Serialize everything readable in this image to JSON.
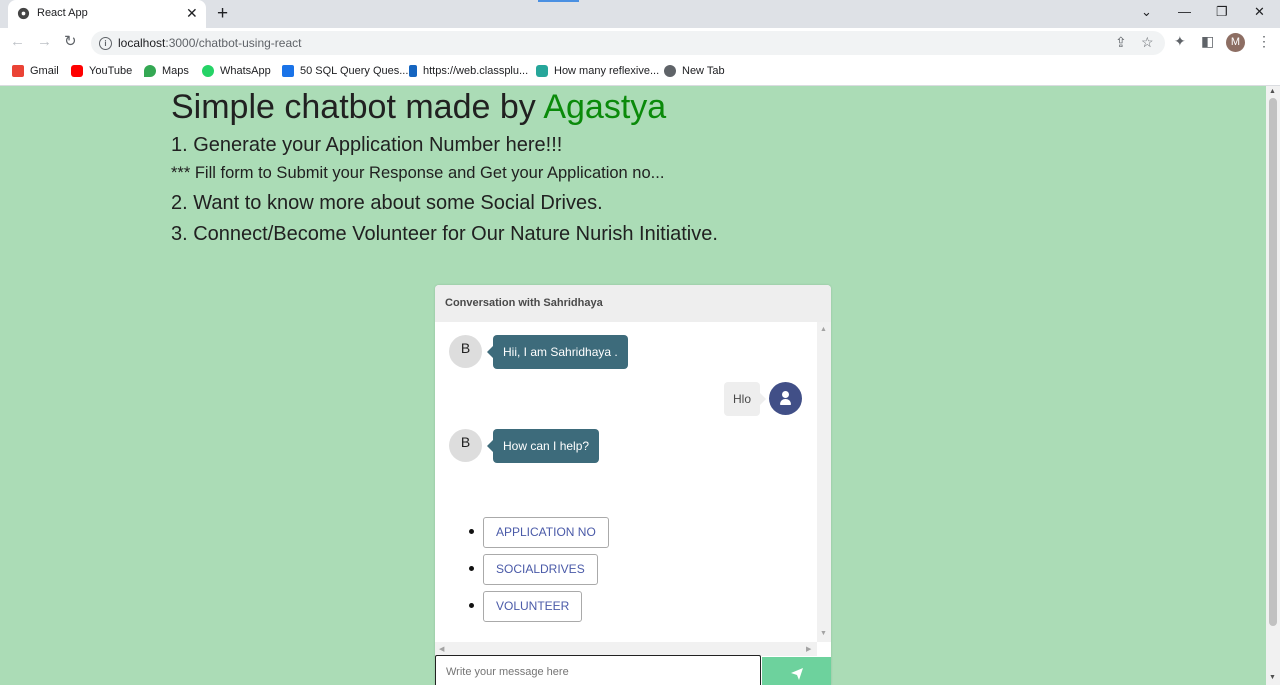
{
  "browser": {
    "tab_title": "React App",
    "tab_close": "✕",
    "new_tab": "+",
    "window_controls": {
      "dropdown": "⌄",
      "minimize": "—",
      "restore": "❐",
      "close": "✕"
    },
    "url_host": "localhost",
    "url_path": ":3000/chatbot-using-react",
    "profile_initial": "M",
    "bookmarks": [
      {
        "label": "Gmail",
        "icon": "gmail-icon",
        "color": "#ea4335"
      },
      {
        "label": "YouTube",
        "icon": "youtube-icon",
        "color": "#ff0000"
      },
      {
        "label": "Maps",
        "icon": "maps-icon",
        "color": "#34a853"
      },
      {
        "label": "WhatsApp",
        "icon": "whatsapp-icon",
        "color": "#25d366"
      },
      {
        "label": "50 SQL Query Ques...",
        "icon": "sql-icon",
        "color": "#1a73e8"
      },
      {
        "label": "https://web.classplu...",
        "icon": "classplus-icon",
        "color": "#1565c0"
      },
      {
        "label": "How many reflexive...",
        "icon": "bookmark-icon",
        "color": "#26a69a"
      },
      {
        "label": "New Tab",
        "icon": "globe-icon",
        "color": "#5f6368"
      }
    ]
  },
  "page": {
    "heading_prefix": "Simple chatbot made by ",
    "heading_name": "Agastya",
    "line1": "1. Generate your Application Number here!!!",
    "line2": "*** Fill form to Submit your Response and Get your Application no...",
    "line3": "2. Want to know more about some Social Drives.",
    "line4": "3. Connect/Become Volunteer for Our Nature Nurish Initiative.",
    "colors": {
      "background": "#abdcb6",
      "accent": "#0a8a0a"
    }
  },
  "chat": {
    "header": "Conversation with Sahridhaya",
    "bot_avatar_letter": "B",
    "messages": [
      {
        "from": "bot",
        "text": "Hii, I am Sahridhaya ."
      },
      {
        "from": "user",
        "text": "Hlo"
      },
      {
        "from": "bot",
        "text": "How can I help?"
      }
    ],
    "options": [
      "APPLICATION NO",
      "SOCIALDRIVES",
      "VOLUNTEER"
    ],
    "input_placeholder": "Write your message here",
    "colors": {
      "bot_bubble": "#3d6b7b",
      "user_avatar": "#414f87",
      "send_button": "#6dd29d"
    }
  }
}
